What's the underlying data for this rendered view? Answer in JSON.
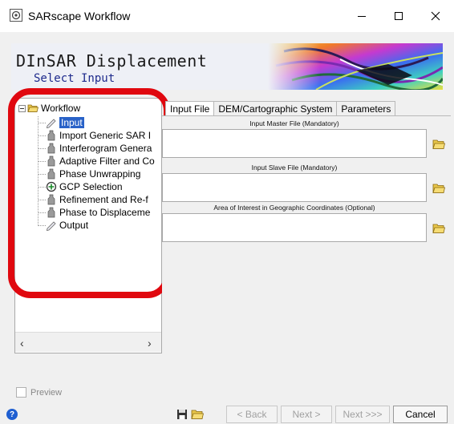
{
  "window": {
    "title": "SARscape Workflow",
    "minimize_glyph": "—",
    "maximize_glyph": "☐",
    "close_glyph": "✕"
  },
  "header": {
    "title": "DInSAR Displacement",
    "subtitle": "Select Input"
  },
  "tree": {
    "root_label": "Workflow",
    "items": [
      {
        "label": "Input",
        "icon": "input-pencil-icon",
        "selected": true
      },
      {
        "label": "Import Generic SAR I",
        "icon": "step-icon"
      },
      {
        "label": "Interferogram Genera",
        "icon": "step-icon"
      },
      {
        "label": "Adaptive Filter and Co",
        "icon": "step-icon"
      },
      {
        "label": "Phase Unwrapping",
        "icon": "step-icon"
      },
      {
        "label": "GCP Selection",
        "icon": "gcp-plus-icon"
      },
      {
        "label": "Refinement and Re-f",
        "icon": "step-icon"
      },
      {
        "label": "Phase to Displaceme",
        "icon": "step-icon"
      },
      {
        "label": "Output",
        "icon": "output-pencil-icon"
      }
    ],
    "scroll_left": "‹",
    "scroll_right": "›"
  },
  "tabs": [
    {
      "label": "Input File",
      "active": true
    },
    {
      "label": "DEM/Cartographic System"
    },
    {
      "label": "Parameters"
    }
  ],
  "input_file": {
    "master_label": "Input Master File (Mandatory)",
    "slave_label": "Input Slave File (Mandatory)",
    "aoi_label": "Area of Interest in Geographic Coordinates (Optional)"
  },
  "preview_label": "Preview",
  "buttons": {
    "help": "?",
    "back": "< Back",
    "next": "Next >",
    "next_all": "Next >>>",
    "cancel": "Cancel"
  },
  "colors": {
    "highlight": "#e0080f",
    "selection": "#2962c8",
    "subtitle": "#1e2a8c"
  }
}
